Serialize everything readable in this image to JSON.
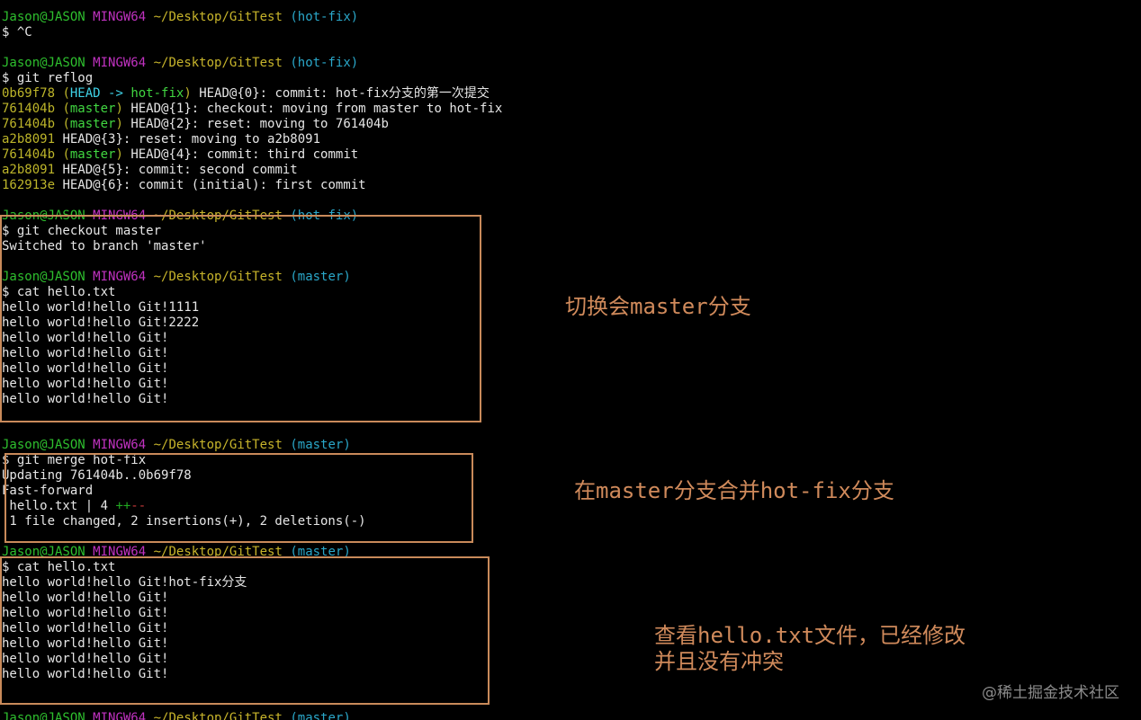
{
  "colors": {
    "background": "#000000",
    "user_host": "#2ebf2e",
    "mingw": "#c032c0",
    "path": "#c7b42b",
    "branch": "#2aa7c9",
    "annotation": "#d08a5b"
  },
  "prompt": {
    "user_host": "Jason@JASON",
    "system": "MINGW64",
    "path": "~/Desktop/GitTest",
    "branch_hotfix": "(hot-fix)",
    "branch_master": "(master)"
  },
  "terminal": {
    "ctrl_c": "$ ^C",
    "cmd_reflog": "$ git reflog",
    "reflog": [
      {
        "hash": "0b69f78",
        "ref_open": " (",
        "head": "HEAD -> ",
        "ref_branch": "hot-fix",
        "ref_close": ")",
        "text": " HEAD@{0}: commit: hot-fix分支的第一次提交"
      },
      {
        "hash": "761404b",
        "ref_open": " (",
        "ref_branch": "master",
        "ref_close": ")",
        "text": " HEAD@{1}: checkout: moving from master to hot-fix"
      },
      {
        "hash": "761404b",
        "ref_open": " (",
        "ref_branch": "master",
        "ref_close": ")",
        "text": " HEAD@{2}: reset: moving to 761404b"
      },
      {
        "hash": "a2b8091",
        "text": " HEAD@{3}: reset: moving to a2b8091"
      },
      {
        "hash": "761404b",
        "ref_open": " (",
        "ref_branch": "master",
        "ref_close": ")",
        "text": " HEAD@{4}: commit: third commit"
      },
      {
        "hash": "a2b8091",
        "text": " HEAD@{5}: commit: second commit"
      },
      {
        "hash": "162913e",
        "text": " HEAD@{6}: commit (initial): first commit"
      }
    ],
    "cmd_checkout": "$ git checkout master",
    "checkout_output": "Switched to branch 'master'",
    "cmd_cat": "$ cat hello.txt",
    "cat1": [
      "hello world!hello Git!1111",
      "hello world!hello Git!2222",
      "hello world!hello Git!",
      "hello world!hello Git!",
      "hello world!hello Git!",
      "hello world!hello Git!",
      "hello world!hello Git!"
    ],
    "cmd_merge": "$ git merge hot-fix",
    "merge_updating": "Updating 761404b..0b69f78",
    "merge_ff": "Fast-forward",
    "merge_file": " hello.txt | 4 ",
    "merge_plus": "++",
    "merge_minus": "--",
    "merge_summary": " 1 file changed, 2 insertions(+), 2 deletions(-)",
    "cat2": [
      "hello world!hello Git!hot-fix分支",
      "hello world!hello Git!",
      "hello world!hello Git!",
      "hello world!hello Git!",
      "hello world!hello Git!",
      "hello world!hello Git!",
      "hello world!hello Git!"
    ]
  },
  "annotations": {
    "switch": "切换会master分支",
    "merge": "在master分支合并hot-fix分支",
    "view_line1": "查看hello.txt文件，已经修改",
    "view_line2": "并且没有冲突"
  },
  "watermark": "@稀土掘金技术社区"
}
